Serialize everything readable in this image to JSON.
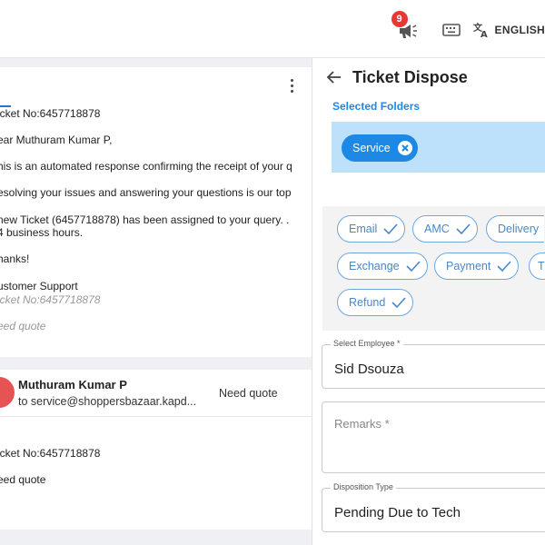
{
  "topbar": {
    "notification_count": "9",
    "language": "ENGLISH",
    "icons": [
      "announcement-icon",
      "keyboard-icon",
      "translate-icon"
    ]
  },
  "email": {
    "lines": [
      "icket No:6457718878",
      "ear Muthuram Kumar P,",
      "his is an automated response confirming the receipt of your q",
      "esolving your issues and answering your questions is our top",
      " new Ticket (6457718878) has been assigned to your query. .",
      "4 business hours.",
      "hanks!",
      "ustomer Support",
      "icket No:6457718878",
      "eed quote"
    ],
    "reply": {
      "sender": "Muthuram Kumar P",
      "to": "to service@shoppersbazaar.kapd...",
      "subject": "Need quote",
      "lines": [
        "icket No:6457718878",
        "eed quote"
      ]
    }
  },
  "panel": {
    "title": "Ticket Dispose",
    "selected_folders_label": "Selected Folders",
    "selected_folder": "Service",
    "folder_options": [
      "Email",
      "AMC",
      "Delivery",
      "Exchange",
      "Payment",
      "T",
      "Refund"
    ],
    "employee": {
      "label": "Select Employee *",
      "value": "Sid Dsouza"
    },
    "remarks": {
      "placeholder": "Remarks *",
      "value": ""
    },
    "disposition": {
      "label": "Disposition Type",
      "value": "Pending Due to Tech"
    }
  },
  "colors": {
    "accent": "#1e88e5",
    "badge": "#e53935",
    "chip_border": "#6ea6dd"
  }
}
